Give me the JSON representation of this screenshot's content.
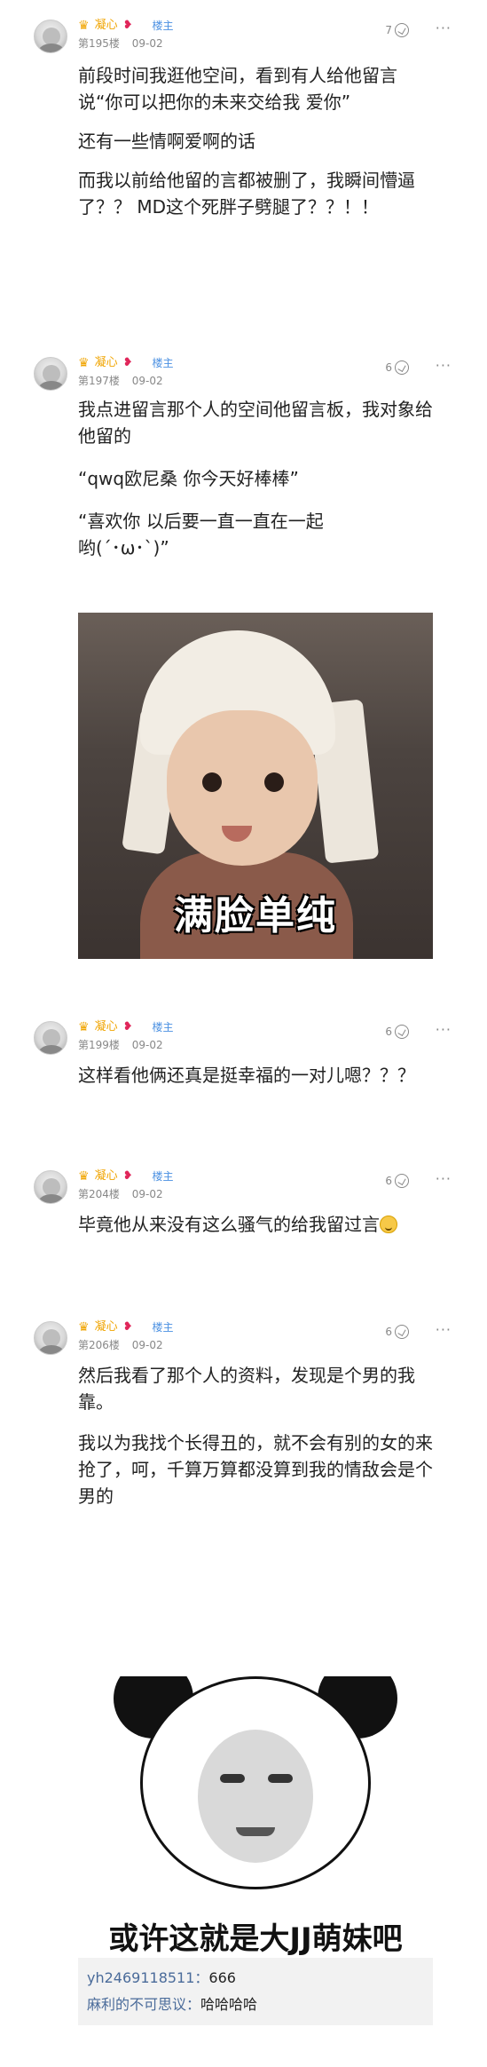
{
  "posts": [
    {
      "username": "凝心",
      "badge": "楼主",
      "floor": "第195楼",
      "date": "09-02",
      "likes": "7",
      "paragraphs": [
        "前段时间我逛他空间，看到有人给他留言说“你可以把你的未来交给我 爱你”",
        "还有一些情啊爱啊的话",
        "而我以前给他留的言都被删了，我瞬间懵逼了？？ MD这个死胖子劈腿了？？！！"
      ]
    },
    {
      "username": "凝心",
      "badge": "楼主",
      "floor": "第197楼",
      "date": "09-02",
      "likes": "6",
      "paragraphs": [
        "我点进留言那个人的空间他留言板，我对象给他留的",
        "“qwq欧尼桑 你今天好棒棒”",
        "“喜欢你 以后要一直一直在一起哟(´･ω･`)”"
      ],
      "image_caption": "满脸单纯"
    },
    {
      "username": "凝心",
      "badge": "楼主",
      "floor": "第199楼",
      "date": "09-02",
      "likes": "6",
      "paragraphs": [
        "这样看他俩还真是挺幸福的一对儿嗯？？？"
      ]
    },
    {
      "username": "凝心",
      "badge": "楼主",
      "floor": "第204楼",
      "date": "09-02",
      "likes": "6",
      "paragraphs": [
        "毕竟他从来没有这么骚气的给我留过言"
      ]
    },
    {
      "username": "凝心",
      "badge": "楼主",
      "floor": "第206楼",
      "date": "09-02",
      "likes": "6",
      "paragraphs": [
        "然后我看了那个人的资料，发现是个男的我靠。",
        "我以为我找个长得丑的，就不会有别的女的来抢了，呵，千算万算都没算到我的情敌会是个男的"
      ],
      "image_caption": "或许这就是大JJ萌妹吧"
    }
  ],
  "comments": [
    {
      "user": "yh2469118511：",
      "text": "666"
    },
    {
      "user": "麻利的不可思议：",
      "text": "哈哈哈哈"
    }
  ],
  "colors": {
    "username": "#f0a400",
    "badge": "#4a90e2",
    "meta": "#888888"
  }
}
